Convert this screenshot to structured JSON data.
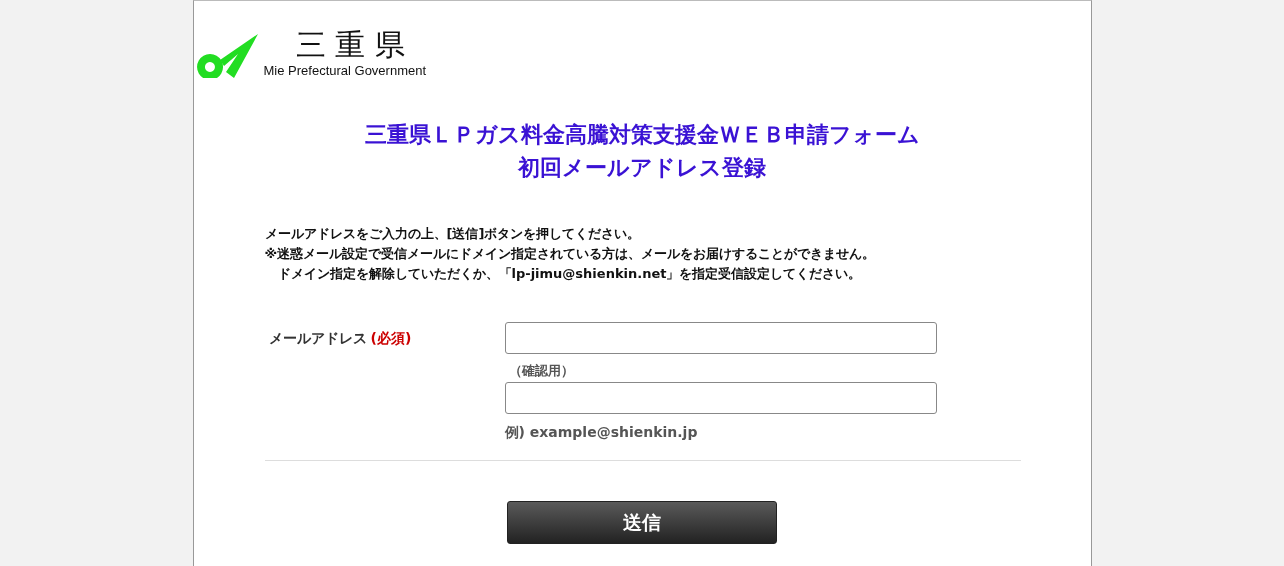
{
  "header": {
    "logo_title": "三 重 県",
    "logo_subtitle": "Mie Prefectural Government"
  },
  "title_lines": [
    "三重県ＬＰガス料金高騰対策支援金ＷＥＢ申請フォーム",
    "初回メールアドレス登録"
  ],
  "instructions": [
    "メールアドレスをご入力の上、[送信]ボタンを押してください。",
    "※迷惑メール設定で受信メールにドメイン指定されている方は、メールをお届けすることができません。",
    "　ドメイン指定を解除していただくか、「lp-jimu@shienkin.net」を指定受信設定してください。"
  ],
  "form": {
    "label": "メールアドレス",
    "required": "(必須)",
    "confirm_label": "（確認用）",
    "example": "例) example@shienkin.jp"
  },
  "submit_button": "送信"
}
